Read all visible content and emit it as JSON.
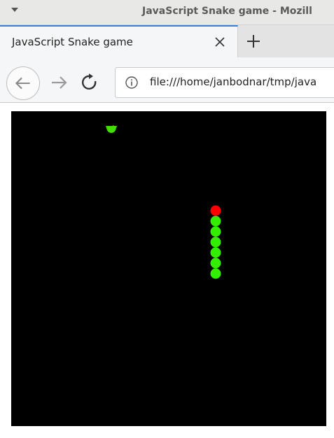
{
  "window": {
    "title": "JavaScript Snake game - Mozill"
  },
  "tab": {
    "title": "JavaScript Snake game"
  },
  "nav": {
    "url": "file:///home/janbodnar/tmp/java"
  },
  "icons": {
    "menu": "window-menu-arrow-icon",
    "close": "close-icon",
    "new_tab": "plus-icon",
    "back": "back-arrow-icon",
    "forward": "forward-arrow-icon",
    "reload": "reload-icon",
    "info": "info-icon"
  },
  "colors": {
    "canvas_background": "#000000",
    "snake_head": "#ff0000",
    "snake_body": "#33ee00",
    "apple": "#44dd00",
    "tab_accent": "#3b7ddb"
  },
  "game": {
    "snake_length": 7,
    "snake_direction": "up"
  }
}
